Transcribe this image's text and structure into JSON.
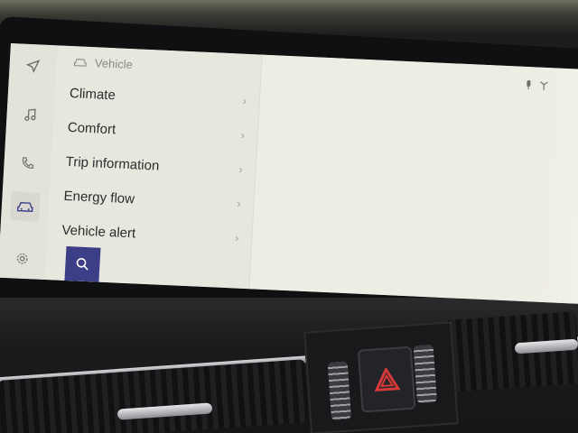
{
  "header": {
    "title": "Vehicle",
    "icon": "car-icon"
  },
  "rail": {
    "items": [
      {
        "icon": "navigation-icon",
        "active": false
      },
      {
        "icon": "music-icon",
        "active": false
      },
      {
        "icon": "phone-icon",
        "active": false
      },
      {
        "icon": "car-icon",
        "active": true
      },
      {
        "icon": "gear-icon",
        "active": false
      }
    ]
  },
  "menu": {
    "items": [
      {
        "label": "Climate"
      },
      {
        "label": "Comfort"
      },
      {
        "label": "Trip information"
      },
      {
        "label": "Energy flow"
      },
      {
        "label": "Vehicle alert"
      }
    ]
  },
  "search": {
    "icon": "search-icon"
  },
  "status": {
    "icons": [
      "microphone-off-icon",
      "signal-icon"
    ]
  },
  "colors": {
    "screen_bg": "#ebeae1",
    "accent": "#3c3f88",
    "text": "#2b2c2e",
    "muted": "#8a8a84"
  }
}
